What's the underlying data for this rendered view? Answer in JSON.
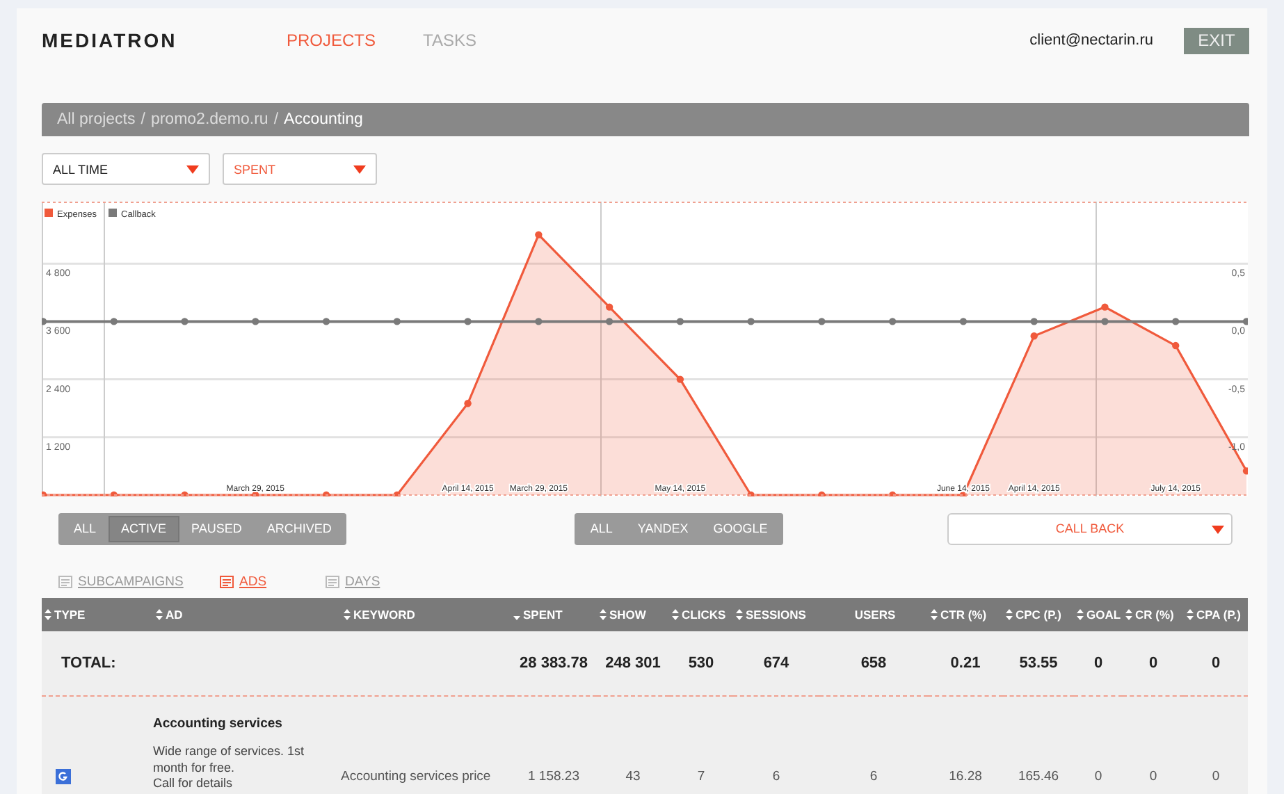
{
  "header": {
    "logo": "MEDIATRON",
    "nav": [
      {
        "label": "PROJECTS",
        "selected": true
      },
      {
        "label": "TASKS",
        "selected": false
      }
    ],
    "user": "client@nectarin.ru",
    "exit_button": "EXIT"
  },
  "breadcrumb": {
    "links": [
      "All projects",
      "promo2.demo.ru"
    ],
    "separator": "/",
    "current": "Accounting"
  },
  "filters": [
    {
      "value": "ALL TIME",
      "highlight": false
    },
    {
      "value": "SPENT",
      "highlight": true
    }
  ],
  "chart": {
    "chart_data": {
      "type": "area",
      "categories": [
        null,
        null,
        null,
        "March 29, 2015",
        null,
        null,
        "April 14, 2015",
        "March 29, 2015",
        null,
        "May 14, 2015",
        null,
        null,
        null,
        "June 14, 2015",
        "April 14, 2015",
        null,
        "July 14, 2015",
        null
      ],
      "series": [
        {
          "name": "Expenses",
          "color": "#f05a3c",
          "marker": true,
          "values": [
            0,
            0,
            0,
            0,
            0,
            0,
            1900,
            5400,
            3900,
            2400,
            0,
            0,
            0,
            0,
            3300,
            3900,
            3100,
            500
          ]
        },
        {
          "name": "Callback",
          "color": "#7a7a7a",
          "axis": "y2",
          "type": "line",
          "marker": true,
          "values": [
            0,
            0,
            0,
            0,
            0,
            0,
            0,
            0,
            0,
            0,
            0,
            0,
            0,
            0,
            0,
            0,
            0,
            0
          ]
        }
      ],
      "grid": true,
      "legend": "top-left",
      "ylim": [
        0,
        6000
      ],
      "yticks": [
        {
          "value": 1200,
          "label": "1 200"
        },
        {
          "value": 2400,
          "label": "2 400"
        },
        {
          "value": 3600,
          "label": "3 600"
        },
        {
          "value": 4800,
          "label": "4 800"
        }
      ],
      "y2lim": [
        -1.5,
        1.0
      ],
      "y2ticks": [
        {
          "value": -1,
          "label": "-1,0"
        },
        {
          "value": -0.5,
          "label": "-0,5"
        },
        {
          "value": 0,
          "label": "0,0"
        },
        {
          "value": 0.5,
          "label": "0,5"
        }
      ]
    }
  },
  "status_filter": [
    {
      "label": "ALL",
      "selected": false
    },
    {
      "label": "ACTIVE",
      "selected": true
    },
    {
      "label": "PAUSED",
      "selected": false
    },
    {
      "label": "ARCHIVED",
      "selected": false
    }
  ],
  "source_filter": [
    {
      "label": "ALL",
      "selected": false
    },
    {
      "label": "YANDEX",
      "selected": false
    },
    {
      "label": "GOOGLE",
      "selected": false
    }
  ],
  "goal_select": "CALL BACK",
  "views": [
    {
      "label": "SUBCAMPAIGNS",
      "selected": false
    },
    {
      "label": "ADS",
      "selected": true
    },
    {
      "label": "DAYS",
      "selected": false
    }
  ],
  "table": {
    "columns": [
      {
        "label": "TYPE",
        "kind": "sortable"
      },
      {
        "label": "AD",
        "kind": "sortable"
      },
      {
        "label": "KEYWORD",
        "kind": "sortable"
      },
      {
        "label": "SPENT",
        "kind": "sorted"
      },
      {
        "label": "SHOW",
        "kind": "sortable"
      },
      {
        "label": "CLICKS",
        "kind": "sortable"
      },
      {
        "label": "SESSIONS",
        "kind": "sortable"
      },
      {
        "label": "USERS",
        "kind": "plain"
      },
      {
        "label": "CTR (%)",
        "kind": "sortable"
      },
      {
        "label": "CPC (P.)",
        "kind": "sortable"
      },
      {
        "label": "GOAL",
        "kind": "sortable"
      },
      {
        "label": "CR (%)",
        "kind": "sortable"
      },
      {
        "label": "CPA (P.)",
        "kind": "sortable"
      }
    ],
    "total": {
      "label": "TOTAL:",
      "values": [
        "28 383.78",
        "248 301",
        "530",
        "674",
        "658",
        "0.21",
        "53.55",
        "0",
        "0",
        "0"
      ]
    },
    "rows": [
      {
        "kind": "google",
        "title": "Accounting services",
        "description": "Wide range of services. 1st month for free.\nCall for details",
        "keyword": "Accounting services price",
        "values": [
          "1 158.23",
          "43",
          "7",
          "6",
          "6",
          "16.28",
          "165.46",
          "0",
          "0",
          "0"
        ]
      }
    ]
  }
}
